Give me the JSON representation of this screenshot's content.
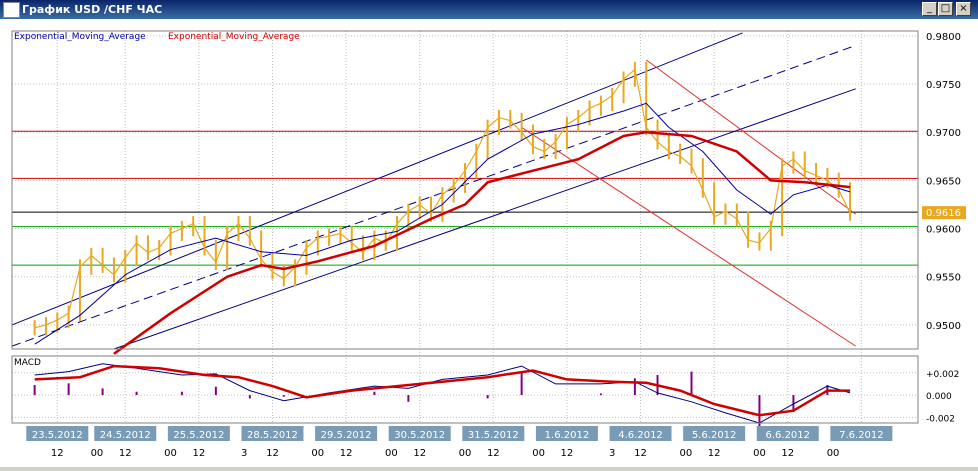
{
  "window": {
    "title": "График USD /CHF  ЧАС",
    "minimize_label": "_",
    "maximize_label": "□",
    "close_label": "×"
  },
  "indicators": {
    "ema_blue_label": "Exponential_Moving_Average",
    "ema_red_label": "Exponential_Moving_Average",
    "macd_label": "MACD"
  },
  "colors": {
    "candles": "#e8a820",
    "ema_fast": "#0000a0",
    "ema_slow": "#d00000",
    "channel_blue": "#000080",
    "channel_red": "#e03030",
    "hline_red": "#d00000",
    "hline_green": "#00a000",
    "hline_black": "#000000",
    "price_tag_bg": "#e8a820",
    "date_label_bg": "#7a9bb5",
    "histogram": "#800080"
  },
  "chart_data": {
    "type": "line",
    "price_ylim": [
      0.9475,
      0.9805
    ],
    "y_ticks": [
      "0.9800",
      "0.9750",
      "0.9700",
      "0.9650",
      "0.9600",
      "0.9550",
      "0.9500"
    ],
    "current_price": "0.9616",
    "horizontal_levels": [
      {
        "value": 0.9701,
        "color": "red"
      },
      {
        "value": 0.9652,
        "color": "red"
      },
      {
        "value": 0.9617,
        "color": "black"
      },
      {
        "value": 0.9602,
        "color": "green"
      },
      {
        "value": 0.9562,
        "color": "green"
      }
    ],
    "price_series": [
      {
        "x": 0,
        "y": 0.9497
      },
      {
        "x": 2,
        "y": 0.95
      },
      {
        "x": 4,
        "y": 0.9505
      },
      {
        "x": 6,
        "y": 0.9512
      },
      {
        "x": 8,
        "y": 0.956
      },
      {
        "x": 10,
        "y": 0.9572
      },
      {
        "x": 12,
        "y": 0.9562
      },
      {
        "x": 14,
        "y": 0.9552
      },
      {
        "x": 16,
        "y": 0.957
      },
      {
        "x": 18,
        "y": 0.9585
      },
      {
        "x": 20,
        "y": 0.9575
      },
      {
        "x": 22,
        "y": 0.958
      },
      {
        "x": 24,
        "y": 0.9595
      },
      {
        "x": 26,
        "y": 0.96
      },
      {
        "x": 28,
        "y": 0.9605
      },
      {
        "x": 30,
        "y": 0.958
      },
      {
        "x": 32,
        "y": 0.9565
      },
      {
        "x": 34,
        "y": 0.9595
      },
      {
        "x": 36,
        "y": 0.9605
      },
      {
        "x": 38,
        "y": 0.959
      },
      {
        "x": 40,
        "y": 0.9568
      },
      {
        "x": 42,
        "y": 0.9555
      },
      {
        "x": 44,
        "y": 0.9548
      },
      {
        "x": 46,
        "y": 0.956
      },
      {
        "x": 48,
        "y": 0.958
      },
      {
        "x": 50,
        "y": 0.959
      },
      {
        "x": 52,
        "y": 0.9592
      },
      {
        "x": 54,
        "y": 0.9595
      },
      {
        "x": 56,
        "y": 0.9585
      },
      {
        "x": 58,
        "y": 0.9575
      },
      {
        "x": 60,
        "y": 0.959
      },
      {
        "x": 62,
        "y": 0.9585
      },
      {
        "x": 64,
        "y": 0.9605
      },
      {
        "x": 66,
        "y": 0.9618
      },
      {
        "x": 68,
        "y": 0.9625
      },
      {
        "x": 70,
        "y": 0.9615
      },
      {
        "x": 72,
        "y": 0.9635
      },
      {
        "x": 74,
        "y": 0.9645
      },
      {
        "x": 76,
        "y": 0.966
      },
      {
        "x": 78,
        "y": 0.968
      },
      {
        "x": 80,
        "y": 0.9705
      },
      {
        "x": 82,
        "y": 0.9715
      },
      {
        "x": 84,
        "y": 0.9712
      },
      {
        "x": 86,
        "y": 0.97
      },
      {
        "x": 88,
        "y": 0.9685
      },
      {
        "x": 90,
        "y": 0.968
      },
      {
        "x": 92,
        "y": 0.969
      },
      {
        "x": 94,
        "y": 0.9708
      },
      {
        "x": 96,
        "y": 0.9715
      },
      {
        "x": 98,
        "y": 0.9725
      },
      {
        "x": 100,
        "y": 0.973
      },
      {
        "x": 102,
        "y": 0.9738
      },
      {
        "x": 104,
        "y": 0.9755
      },
      {
        "x": 106,
        "y": 0.9765
      },
      {
        "x": 108,
        "y": 0.9705
      },
      {
        "x": 110,
        "y": 0.969
      },
      {
        "x": 112,
        "y": 0.968
      },
      {
        "x": 114,
        "y": 0.9675
      },
      {
        "x": 116,
        "y": 0.9665
      },
      {
        "x": 118,
        "y": 0.964
      },
      {
        "x": 120,
        "y": 0.9612
      },
      {
        "x": 122,
        "y": 0.9618
      },
      {
        "x": 124,
        "y": 0.961
      },
      {
        "x": 126,
        "y": 0.9588
      },
      {
        "x": 128,
        "y": 0.9585
      },
      {
        "x": 130,
        "y": 0.96
      },
      {
        "x": 132,
        "y": 0.9665
      },
      {
        "x": 134,
        "y": 0.9672
      },
      {
        "x": 136,
        "y": 0.966
      },
      {
        "x": 138,
        "y": 0.9655
      },
      {
        "x": 140,
        "y": 0.965
      },
      {
        "x": 142,
        "y": 0.964
      },
      {
        "x": 144,
        "y": 0.9616
      }
    ],
    "ema_fast_series": [
      {
        "x": 0,
        "y": 0.948
      },
      {
        "x": 8,
        "y": 0.951
      },
      {
        "x": 16,
        "y": 0.9552
      },
      {
        "x": 24,
        "y": 0.9578
      },
      {
        "x": 32,
        "y": 0.959
      },
      {
        "x": 40,
        "y": 0.9576
      },
      {
        "x": 48,
        "y": 0.9572
      },
      {
        "x": 56,
        "y": 0.9588
      },
      {
        "x": 64,
        "y": 0.9597
      },
      {
        "x": 72,
        "y": 0.9625
      },
      {
        "x": 80,
        "y": 0.9672
      },
      {
        "x": 88,
        "y": 0.9698
      },
      {
        "x": 96,
        "y": 0.9708
      },
      {
        "x": 104,
        "y": 0.9722
      },
      {
        "x": 108,
        "y": 0.973
      },
      {
        "x": 112,
        "y": 0.9705
      },
      {
        "x": 118,
        "y": 0.968
      },
      {
        "x": 124,
        "y": 0.964
      },
      {
        "x": 130,
        "y": 0.9615
      },
      {
        "x": 134,
        "y": 0.9635
      },
      {
        "x": 140,
        "y": 0.9645
      },
      {
        "x": 144,
        "y": 0.9638
      }
    ],
    "ema_slow_series": [
      {
        "x": 14,
        "y": 0.947
      },
      {
        "x": 24,
        "y": 0.9512
      },
      {
        "x": 34,
        "y": 0.955
      },
      {
        "x": 40,
        "y": 0.9562
      },
      {
        "x": 44,
        "y": 0.9558
      },
      {
        "x": 50,
        "y": 0.9566
      },
      {
        "x": 60,
        "y": 0.9582
      },
      {
        "x": 70,
        "y": 0.961
      },
      {
        "x": 76,
        "y": 0.9625
      },
      {
        "x": 80,
        "y": 0.9648
      },
      {
        "x": 88,
        "y": 0.966
      },
      {
        "x": 96,
        "y": 0.9672
      },
      {
        "x": 104,
        "y": 0.9696
      },
      {
        "x": 108,
        "y": 0.97
      },
      {
        "x": 116,
        "y": 0.9696
      },
      {
        "x": 124,
        "y": 0.968
      },
      {
        "x": 130,
        "y": 0.965
      },
      {
        "x": 136,
        "y": 0.9648
      },
      {
        "x": 144,
        "y": 0.9643
      }
    ],
    "macd_ylim": [
      -0.0025,
      0.0035
    ],
    "macd_ticks": [
      "+0.002",
      "0.000",
      "-0.002"
    ],
    "macd_line": [
      {
        "x": 0,
        "y": 0.0018
      },
      {
        "x": 6,
        "y": 0.0021
      },
      {
        "x": 12,
        "y": 0.0028
      },
      {
        "x": 18,
        "y": 0.0024
      },
      {
        "x": 26,
        "y": 0.0018
      },
      {
        "x": 32,
        "y": 0.0019
      },
      {
        "x": 38,
        "y": 0.0004
      },
      {
        "x": 44,
        "y": -0.0005
      },
      {
        "x": 52,
        "y": 0.0002
      },
      {
        "x": 60,
        "y": 0.0008
      },
      {
        "x": 66,
        "y": 0.0006
      },
      {
        "x": 72,
        "y": 0.0014
      },
      {
        "x": 80,
        "y": 0.0018
      },
      {
        "x": 86,
        "y": 0.0026
      },
      {
        "x": 92,
        "y": 0.001
      },
      {
        "x": 100,
        "y": 0.001
      },
      {
        "x": 106,
        "y": 0.0012
      },
      {
        "x": 110,
        "y": 0.0002
      },
      {
        "x": 116,
        "y": -0.0006
      },
      {
        "x": 122,
        "y": -0.0016
      },
      {
        "x": 128,
        "y": -0.0025
      },
      {
        "x": 134,
        "y": -0.0008
      },
      {
        "x": 140,
        "y": 0.0008
      },
      {
        "x": 144,
        "y": 0.0002
      }
    ],
    "signal_line": [
      {
        "x": 0,
        "y": 0.0014
      },
      {
        "x": 8,
        "y": 0.0016
      },
      {
        "x": 14,
        "y": 0.0026
      },
      {
        "x": 22,
        "y": 0.0024
      },
      {
        "x": 30,
        "y": 0.0018
      },
      {
        "x": 36,
        "y": 0.0016
      },
      {
        "x": 42,
        "y": 0.0008
      },
      {
        "x": 48,
        "y": -0.0002
      },
      {
        "x": 56,
        "y": 0.0004
      },
      {
        "x": 64,
        "y": 0.0008
      },
      {
        "x": 72,
        "y": 0.0012
      },
      {
        "x": 80,
        "y": 0.0016
      },
      {
        "x": 88,
        "y": 0.0022
      },
      {
        "x": 94,
        "y": 0.0014
      },
      {
        "x": 102,
        "y": 0.0012
      },
      {
        "x": 108,
        "y": 0.0011
      },
      {
        "x": 114,
        "y": 0.0004
      },
      {
        "x": 120,
        "y": -0.0008
      },
      {
        "x": 128,
        "y": -0.0018
      },
      {
        "x": 134,
        "y": -0.0014
      },
      {
        "x": 140,
        "y": 0.0004
      },
      {
        "x": 144,
        "y": 0.0004
      }
    ],
    "x_range": [
      -4,
      156
    ],
    "date_labels": [
      {
        "x": 4,
        "text": "23.5.2012"
      },
      {
        "x": 16,
        "text": "24.5.2012"
      },
      {
        "x": 29,
        "text": "25.5.2012"
      },
      {
        "x": 42,
        "text": "28.5.2012"
      },
      {
        "x": 55,
        "text": "29.5.2012"
      },
      {
        "x": 68,
        "text": "30.5.2012"
      },
      {
        "x": 81,
        "text": "31.5.2012"
      },
      {
        "x": 94,
        "text": "1.6.2012"
      },
      {
        "x": 107,
        "text": "4.6.2012"
      },
      {
        "x": 120,
        "text": "5.6.2012"
      },
      {
        "x": 133,
        "text": "6.6.2012"
      },
      {
        "x": 146,
        "text": "7.6.2012"
      }
    ],
    "hour_labels": [
      {
        "x": 4,
        "text": "12"
      },
      {
        "x": 11,
        "text": "00"
      },
      {
        "x": 16,
        "text": "12"
      },
      {
        "x": 24,
        "text": "00"
      },
      {
        "x": 29,
        "text": "12"
      },
      {
        "x": 37,
        "text": "3"
      },
      {
        "x": 42,
        "text": "12"
      },
      {
        "x": 50,
        "text": "00"
      },
      {
        "x": 55,
        "text": "12"
      },
      {
        "x": 63,
        "text": "00"
      },
      {
        "x": 68,
        "text": "12"
      },
      {
        "x": 76,
        "text": "00"
      },
      {
        "x": 81,
        "text": "12"
      },
      {
        "x": 89,
        "text": "00"
      },
      {
        "x": 94,
        "text": "12"
      },
      {
        "x": 102,
        "text": "3"
      },
      {
        "x": 107,
        "text": "12"
      },
      {
        "x": 115,
        "text": "00"
      },
      {
        "x": 120,
        "text": "12"
      },
      {
        "x": 128,
        "text": "00"
      },
      {
        "x": 133,
        "text": "12"
      },
      {
        "x": 141,
        "text": "00"
      }
    ],
    "channels": [
      {
        "color": "blue",
        "style": "solid",
        "x1": -4,
        "y1": 0.95,
        "x2": 125,
        "y2": 0.9803
      },
      {
        "color": "blue",
        "style": "dashed",
        "x1": -4,
        "y1": 0.9478,
        "x2": 145,
        "y2": 0.979
      },
      {
        "color": "blue",
        "style": "solid",
        "x1": 14,
        "y1": 0.9475,
        "x2": 145,
        "y2": 0.9745
      },
      {
        "color": "red",
        "style": "solid",
        "x1": 108,
        "y1": 0.9775,
        "x2": 145,
        "y2": 0.9615
      },
      {
        "color": "red",
        "style": "solid",
        "x1": 86,
        "y1": 0.9705,
        "x2": 145,
        "y2": 0.9478
      }
    ]
  }
}
